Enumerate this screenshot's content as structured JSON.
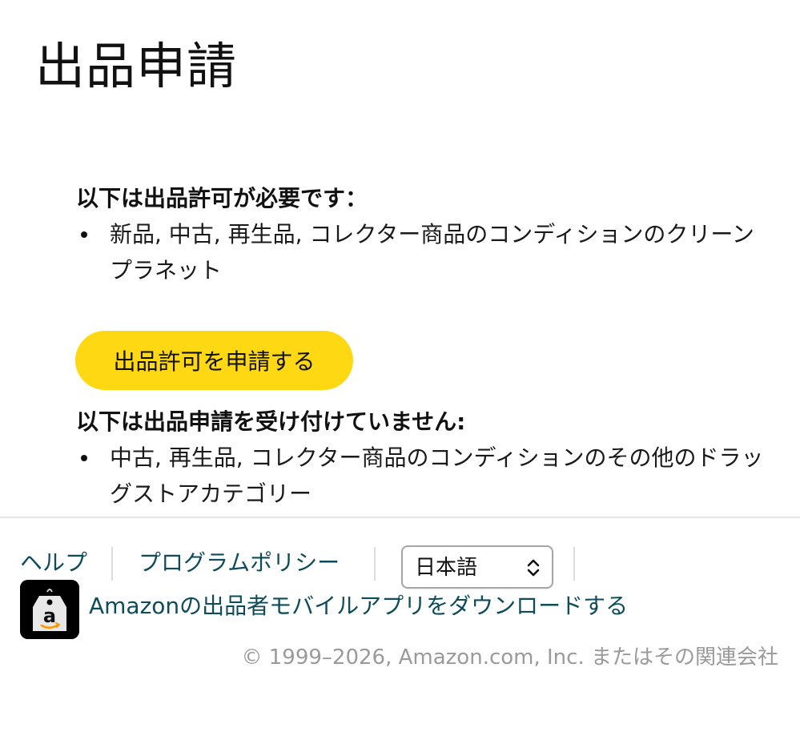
{
  "header": {
    "title": "出品申請"
  },
  "approval_required": {
    "heading": "以下は出品許可が必要です：",
    "items": [
      "新品, 中古, 再生品, コレクター商品のコンディションのクリーンプラネット"
    ]
  },
  "apply_button": {
    "label": "出品許可を申請する",
    "color": "#ffd814"
  },
  "not_accepted": {
    "heading": "以下は出品申請を受け付けていません:",
    "items": [
      "中古, 再生品, コレクター商品のコンディションのその他のドラッグストアカテゴリー"
    ]
  },
  "footer": {
    "help_label": "ヘルプ",
    "program_policy_label": "プログラムポリシー",
    "language_select": {
      "selected": "日本語",
      "icon": "up-down-chevron-icon"
    },
    "app_icon": "amazon-seller-app-icon",
    "app_link_label": "Amazonの出品者モバイルアプリをダウンロードする",
    "copyright": "© 1999–2026, Amazon.com, Inc. またはその関連会社",
    "link_color": "#0f4c5a"
  }
}
